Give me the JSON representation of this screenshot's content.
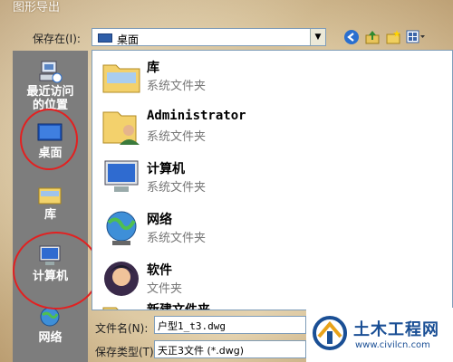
{
  "dialog": {
    "title": "图形导出",
    "save_in_label": "保存在(I):",
    "save_in_value": "桌面"
  },
  "places": [
    {
      "label_line1": "最近访问",
      "label_line2": "的位置",
      "icon": "recent-places-icon"
    },
    {
      "label_line1": "桌面",
      "label_line2": "",
      "icon": "desktop-icon"
    },
    {
      "label_line1": "库",
      "label_line2": "",
      "icon": "libraries-icon"
    },
    {
      "label_line1": "计算机",
      "label_line2": "",
      "icon": "computer-icon"
    },
    {
      "label_line1": "网络",
      "label_line2": "",
      "icon": "network-icon"
    }
  ],
  "files": [
    {
      "name": "库",
      "type": "系统文件夹",
      "icon": "libraries-folder-icon"
    },
    {
      "name": "Administrator",
      "type": "系统文件夹",
      "icon": "user-folder-icon"
    },
    {
      "name": "计算机",
      "type": "系统文件夹",
      "icon": "computer-icon"
    },
    {
      "name": "网络",
      "type": "系统文件夹",
      "icon": "network-globe-icon"
    },
    {
      "name": "软件",
      "type": "文件夹",
      "icon": "avatar-folder-icon"
    },
    {
      "name": "新建文件夹",
      "type": "",
      "icon": "folder-icon"
    }
  ],
  "bottom": {
    "filename_label": "文件名(N):",
    "filename_value": "户型1_t3.dwg",
    "filetype_label": "保存类型(T):",
    "filetype_value": "天正3文件 (*.dwg)"
  },
  "watermark": {
    "title": "土木工程网",
    "url": "www.civilcn.com"
  },
  "colors": {
    "highlight_circle": "#e32020",
    "places_bg": "#7d7d7d"
  }
}
